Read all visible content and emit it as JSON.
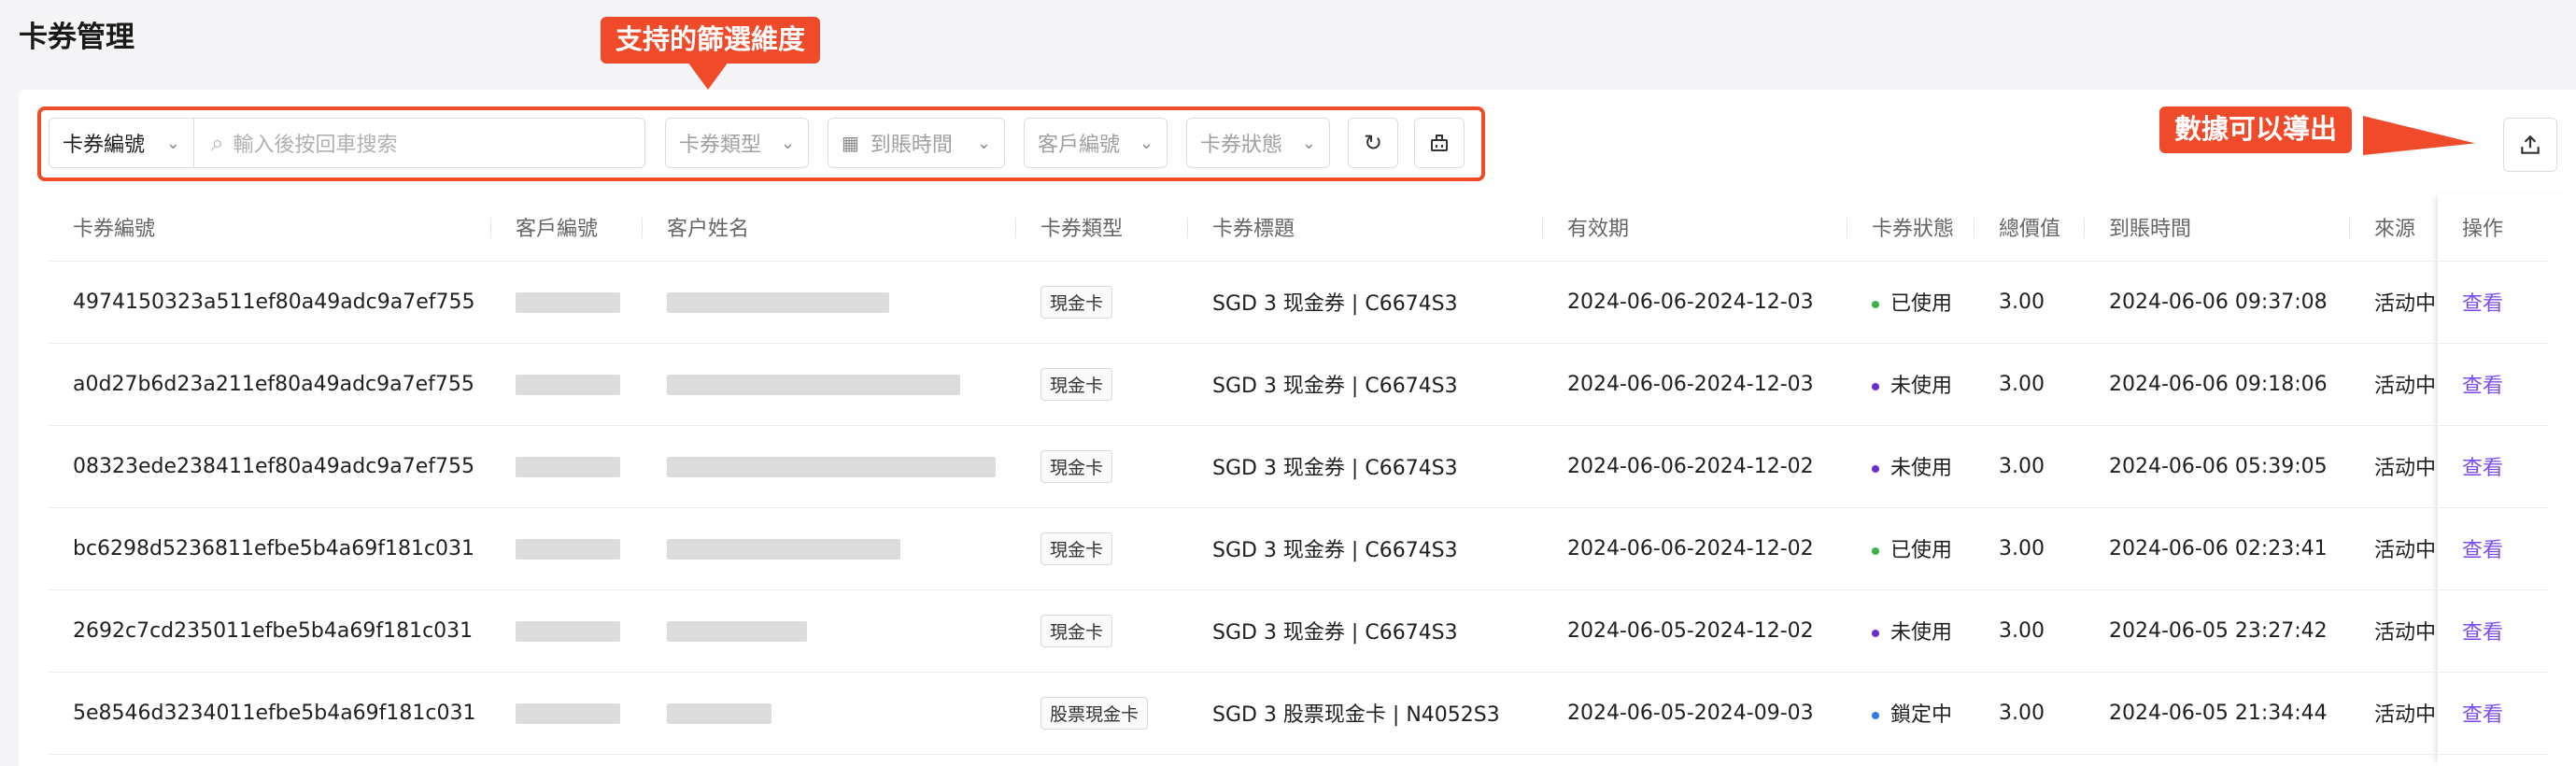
{
  "page_title": "卡券管理",
  "callouts": {
    "filters": "支持的篩選維度",
    "export": "數據可以導出"
  },
  "filters": {
    "key_select": "卡券編號",
    "search_placeholder": "輸入後按回車搜索",
    "type": "卡券類型",
    "date": "到賬時間",
    "customer": "客戶編號",
    "status": "卡券狀態"
  },
  "icons": {
    "search": "search-icon",
    "calendar": "calendar-icon",
    "chevron": "chevron-down-icon",
    "refresh": "refresh-icon",
    "clear": "clear-filter-icon",
    "export": "export-icon"
  },
  "table": {
    "columns": [
      "卡券編號",
      "客戶編號",
      "客户姓名",
      "卡券類型",
      "卡券標題",
      "有效期",
      "卡券狀態",
      "總價值",
      "到賬時間",
      "來源",
      "操作"
    ],
    "rows": [
      {
        "code": "4974150323a511ef80a49adc9a7ef755",
        "type": "現金卡",
        "title": "SGD 3 现金券 | C6674S3",
        "validity": "2024-06-06-2024-12-03",
        "status": "已使用",
        "status_color": "#3cb043",
        "value": "3.00",
        "time": "2024-06-06 09:37:08",
        "source": "活动中",
        "action": "查看",
        "name_w": 238
      },
      {
        "code": "a0d27b6d23a211ef80a49adc9a7ef755",
        "type": "現金卡",
        "title": "SGD 3 现金券 | C6674S3",
        "validity": "2024-06-06-2024-12-03",
        "status": "未使用",
        "status_color": "#6a2fc9",
        "value": "3.00",
        "time": "2024-06-06 09:18:06",
        "source": "活动中",
        "action": "查看",
        "name_w": 314
      },
      {
        "code": "08323ede238411ef80a49adc9a7ef755",
        "type": "現金卡",
        "title": "SGD 3 现金券 | C6674S3",
        "validity": "2024-06-06-2024-12-02",
        "status": "未使用",
        "status_color": "#6a2fc9",
        "value": "3.00",
        "time": "2024-06-06 05:39:05",
        "source": "活动中",
        "action": "查看",
        "name_w": 352
      },
      {
        "code": "bc6298d5236811efbe5b4a69f181c031",
        "type": "現金卡",
        "title": "SGD 3 现金券 | C6674S3",
        "validity": "2024-06-06-2024-12-02",
        "status": "已使用",
        "status_color": "#3cb043",
        "value": "3.00",
        "time": "2024-06-06 02:23:41",
        "source": "活动中",
        "action": "查看",
        "name_w": 250
      },
      {
        "code": "2692c7cd235011efbe5b4a69f181c031",
        "type": "現金卡",
        "title": "SGD 3 现金券 | C6674S3",
        "validity": "2024-06-05-2024-12-02",
        "status": "未使用",
        "status_color": "#6a2fc9",
        "value": "3.00",
        "time": "2024-06-05 23:27:42",
        "source": "活动中",
        "action": "查看",
        "name_w": 150
      },
      {
        "code": "5e8546d3234011efbe5b4a69f181c031",
        "type": "股票現金卡",
        "title": "SGD 3 股票现金卡 | N4052S3",
        "validity": "2024-06-05-2024-09-03",
        "status": "鎖定中",
        "status_color": "#2f7ae5",
        "value": "3.00",
        "time": "2024-06-05 21:34:44",
        "source": "活动中",
        "action": "查看",
        "name_w": 112
      }
    ]
  }
}
